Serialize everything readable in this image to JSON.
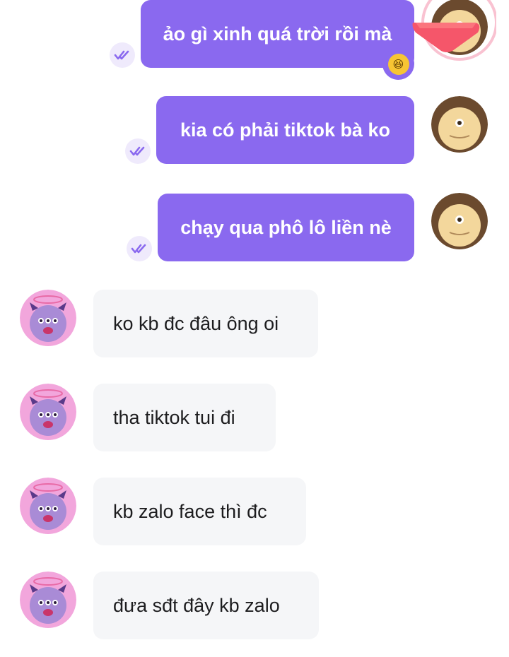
{
  "messages_out": [
    {
      "text": "ảo gì xinh quá trời rồi mà",
      "reaction": "😆"
    },
    {
      "text": "kia có phải tiktok bà ko"
    },
    {
      "text": "chạy qua phô lô liền nè"
    }
  ],
  "messages_in": [
    {
      "text": "ko kb đc đâu ông oi"
    },
    {
      "text": "tha tiktok tui đi"
    },
    {
      "text": "kb zalo face thì đc"
    },
    {
      "text": "đưa sđt đây kb zalo"
    }
  ],
  "colors": {
    "outgoing_bubble": "#8a69ef",
    "incoming_bubble": "#f5f6f8",
    "tick_bg": "#efeafc",
    "tick_stroke": "#8a69ef"
  },
  "icons": {
    "read_receipt": "double-check-icon",
    "sender_avatar": "brown-monster-avatar",
    "receiver_avatar": "purple-devil-monster-avatar",
    "reaction": "laughing-face-icon"
  }
}
